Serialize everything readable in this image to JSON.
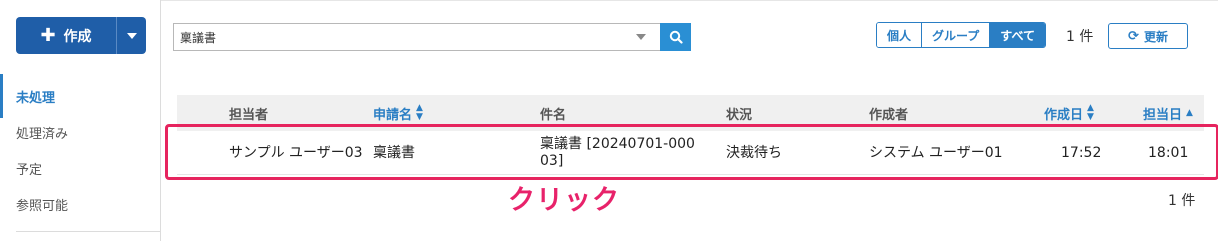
{
  "sidebar": {
    "create_button": {
      "plus_icon": "plus-icon",
      "label": "作成"
    },
    "items": [
      {
        "label": "未処理",
        "active": true
      },
      {
        "label": "処理済み",
        "active": false
      },
      {
        "label": "予定",
        "active": false
      },
      {
        "label": "参照可能",
        "active": false
      }
    ]
  },
  "search": {
    "value": "稟議書",
    "button_icon": "search-icon"
  },
  "scope_filter": {
    "options": [
      {
        "label": "個人"
      },
      {
        "label": "グループ"
      },
      {
        "label": "すべて"
      }
    ],
    "selected": "すべて"
  },
  "result_count_top": "1 件",
  "refresh_button": {
    "icon": "refresh-icon",
    "label": "更新"
  },
  "table": {
    "columns": [
      {
        "label": "担当者",
        "sortable": false
      },
      {
        "label": "申請名",
        "sortable": true,
        "sort": "both"
      },
      {
        "label": "件名",
        "sortable": false
      },
      {
        "label": "状況",
        "sortable": false
      },
      {
        "label": "作成者",
        "sortable": false
      },
      {
        "label": "作成日",
        "sortable": true,
        "sort": "both"
      },
      {
        "label": "担当日",
        "sortable": true,
        "sort": "asc"
      }
    ],
    "rows": [
      {
        "assignee": "サンプル ユーザー03",
        "application": "稟議書",
        "subject": "稟議書 [20240701-00003]",
        "status": "決裁待ち",
        "creator": "システム ユーザー01",
        "created": "17:52",
        "assigned": "18:01"
      }
    ]
  },
  "annotation": "クリック",
  "result_count_bottom": "1 件",
  "colors": {
    "primary": "#1f5ea8",
    "accent": "#2a7ec4",
    "highlight": "#e6245e"
  }
}
